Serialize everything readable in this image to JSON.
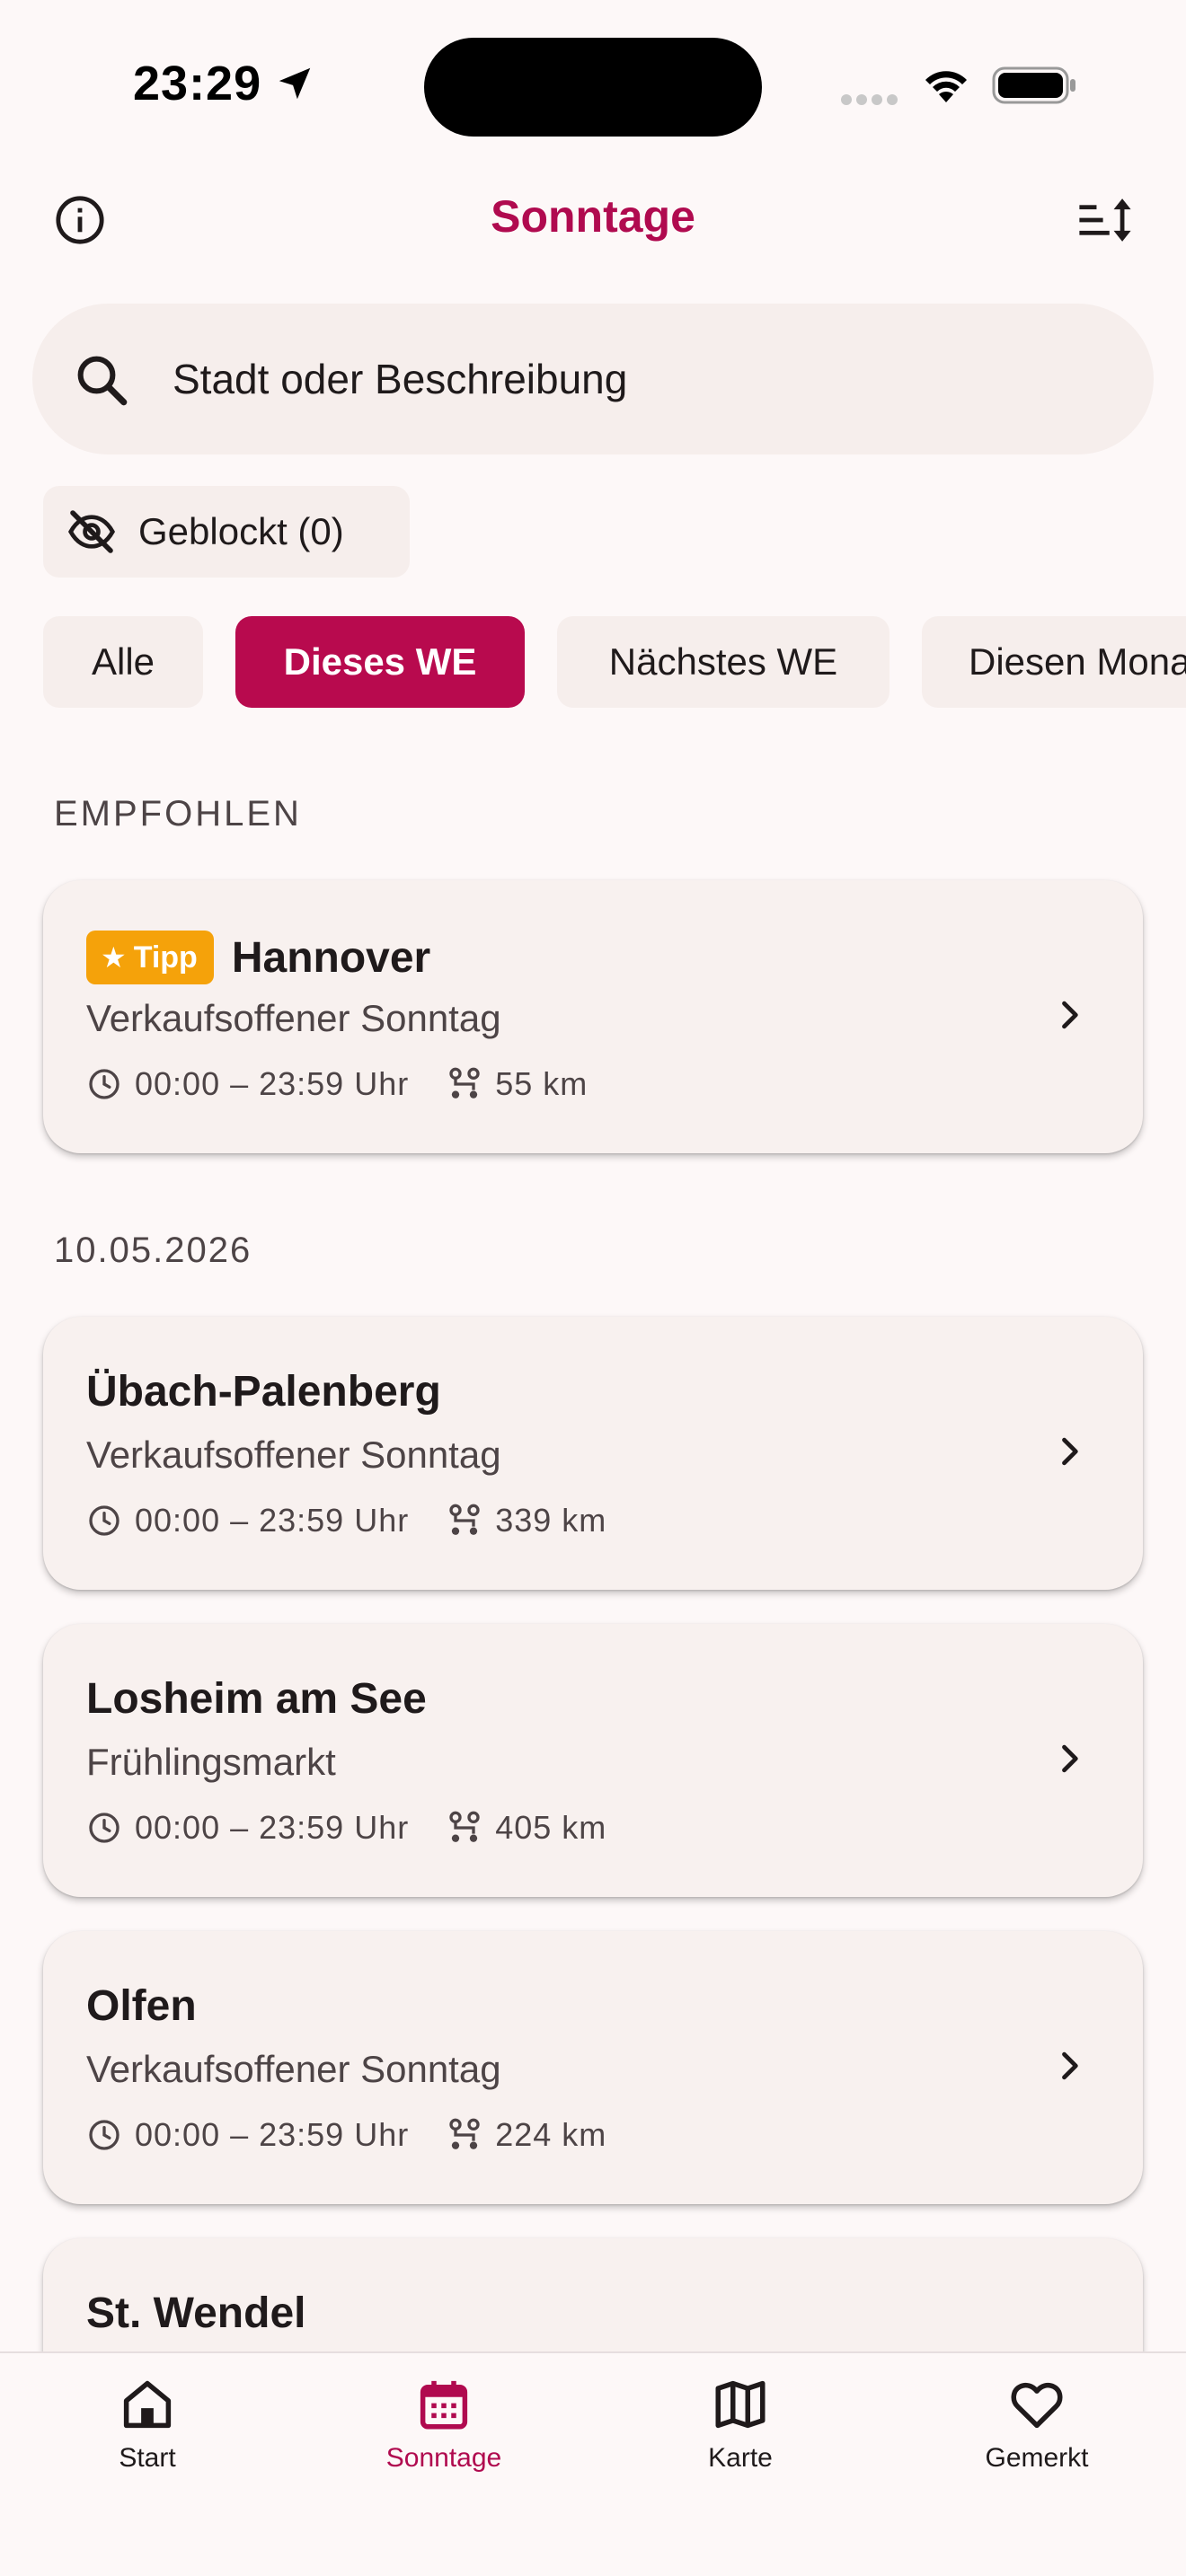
{
  "status_bar": {
    "time": "23:29"
  },
  "header": {
    "title": "Sonntage"
  },
  "search": {
    "placeholder": "Stadt oder Beschreibung"
  },
  "blocked": {
    "label": "Geblockt (0)"
  },
  "filters": [
    {
      "label": "Alle",
      "active": false
    },
    {
      "label": "Dieses WE",
      "active": true
    },
    {
      "label": "Nächstes WE",
      "active": false
    },
    {
      "label": "Diesen Monat",
      "active": false
    }
  ],
  "recommended": {
    "section_label": "EMPFOHLEN",
    "badge": "Tipp",
    "card": {
      "title": "Hannover",
      "subtitle": "Verkaufsoffener Sonntag",
      "time": "00:00 – 23:59 Uhr",
      "distance": "55 km"
    }
  },
  "date_group": {
    "date_label": "10.05.2026",
    "cards": [
      {
        "title": "Übach-Palenberg",
        "subtitle": "Verkaufsoffener Sonntag",
        "time": "00:00 – 23:59 Uhr",
        "distance": "339 km"
      },
      {
        "title": "Losheim am See",
        "subtitle": "Frühlingsmarkt",
        "time": "00:00 – 23:59 Uhr",
        "distance": "405 km"
      },
      {
        "title": "Olfen",
        "subtitle": "Verkaufsoffener Sonntag",
        "time": "00:00 – 23:59 Uhr",
        "distance": "224 km"
      },
      {
        "title": "St. Wendel"
      }
    ]
  },
  "bottom_nav": [
    {
      "label": "Start",
      "icon": "home-icon",
      "active": false
    },
    {
      "label": "Sonntage",
      "icon": "calendar-icon",
      "active": true
    },
    {
      "label": "Karte",
      "icon": "map-icon",
      "active": false
    },
    {
      "label": "Gemerkt",
      "icon": "heart-icon",
      "active": false
    }
  ],
  "colors": {
    "accent": "#b00a4f",
    "badge": "#f5a20a",
    "surface": "#f8f1ef",
    "background": "#fdf8f8"
  }
}
